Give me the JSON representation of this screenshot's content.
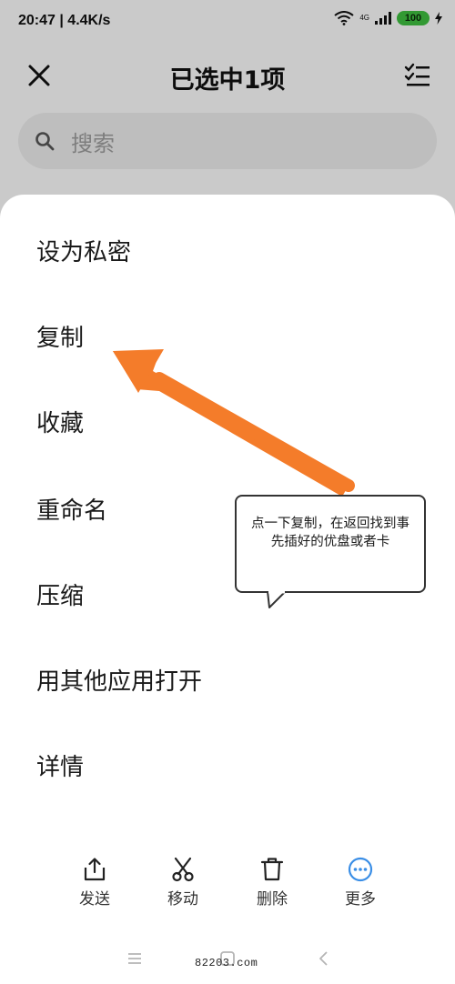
{
  "status_bar": {
    "time": "20:47 | 4.4K/s",
    "network": "4G",
    "battery": "100"
  },
  "header": {
    "title": "已选中1项",
    "icons": [
      "close-icon",
      "select-all-icon"
    ]
  },
  "search": {
    "placeholder": "搜索",
    "icon": "search-icon"
  },
  "menu": {
    "items": [
      {
        "label": "设为私密"
      },
      {
        "label": "复制"
      },
      {
        "label": "收藏"
      },
      {
        "label": "重命名"
      },
      {
        "label": "压缩"
      },
      {
        "label": "用其他应用打开"
      },
      {
        "label": "详情"
      }
    ]
  },
  "toolbar": {
    "items": [
      {
        "label": "发送",
        "icon": "share-icon"
      },
      {
        "label": "移动",
        "icon": "scissors-icon"
      },
      {
        "label": "删除",
        "icon": "trash-icon"
      },
      {
        "label": "更多",
        "icon": "more-icon"
      }
    ]
  },
  "annotation": {
    "text": "点一下复制，在返回找到事先插好的优盘或者卡"
  },
  "watermark": {
    "text": "82203.com"
  },
  "colors": {
    "accent": "#3a8ee6",
    "arrow": "#f47c2a",
    "battery": "#3dbb3f"
  }
}
